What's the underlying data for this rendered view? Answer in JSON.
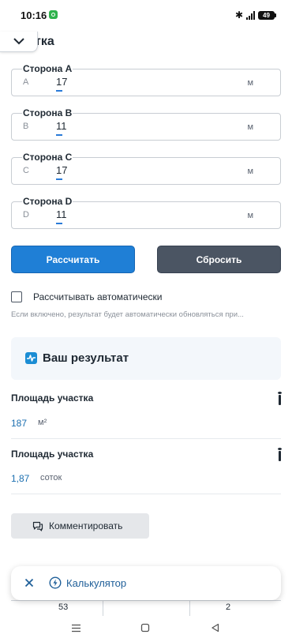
{
  "status": {
    "time": "10:16",
    "battery": "49"
  },
  "section": {
    "title": "тка"
  },
  "fields": [
    {
      "label": "Сторона A",
      "letter": "A",
      "value": "17",
      "unit": "м"
    },
    {
      "label": "Сторона B",
      "letter": "B",
      "value": "11",
      "unit": "м"
    },
    {
      "label": "Сторона C",
      "letter": "C",
      "value": "17",
      "unit": "м"
    },
    {
      "label": "Сторона D",
      "letter": "D",
      "value": "11",
      "unit": "м"
    }
  ],
  "buttons": {
    "calculate": "Рассчитать",
    "reset": "Сбросить"
  },
  "auto": {
    "label": "Рассчитывать автоматически",
    "hint": "Если включено, результат будет автоматически обновляться при...",
    "checked": false
  },
  "result": {
    "title": "Ваш результат",
    "rows": [
      {
        "label": "Площадь участка",
        "value": "187",
        "unit": "м²"
      },
      {
        "label": "Площадь участка",
        "value": "1,87",
        "unit": "соток"
      }
    ]
  },
  "comment": {
    "label": "Комментировать"
  },
  "calculator_bar": {
    "label": "Калькулятор"
  },
  "table_peek": {
    "left": "53",
    "right": "2"
  },
  "colors": {
    "accent": "#1f7fd6",
    "reset": "#4b5563",
    "result_value": "#1b6fb0"
  }
}
